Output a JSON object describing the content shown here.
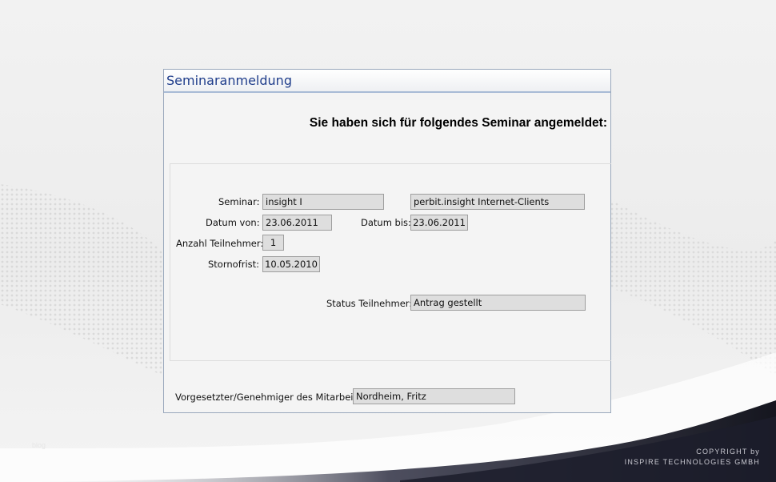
{
  "window": {
    "title": "Seminaranmeldung"
  },
  "headline": "Sie haben sich für folgendes Seminar angemeldet:",
  "form": {
    "seminar_label": "Seminar:",
    "seminar_value": "insight I",
    "seminar_desc_value": "perbit.insight Internet-Clients",
    "datum_von_label": "Datum von:",
    "datum_von_value": "23.06.2011",
    "datum_bis_label": "Datum bis:",
    "datum_bis_value": "23.06.2011",
    "anzahl_label": "Anzahl Teilnehmer:",
    "anzahl_value": "1",
    "stornofrist_label": "Stornofrist:",
    "stornofrist_value": "10.05.2010",
    "status_label": "Status Teilnehmer:",
    "status_value": "Antrag gestellt",
    "vorgesetzter_label": "Vorgesetzter/Genehmiger des Mitarbeiters:",
    "vorgesetzter_value": "Nordheim, Fritz"
  },
  "footer": {
    "copyright_line1": "COPYRIGHT by",
    "copyright_line2": "INSPIRE TECHNOLOGIES GMBH",
    "faint_note": "blog"
  },
  "colors": {
    "title_blue": "#1f3d8b",
    "field_bg": "#dedede",
    "wave_dark": "#1c1d2c"
  }
}
